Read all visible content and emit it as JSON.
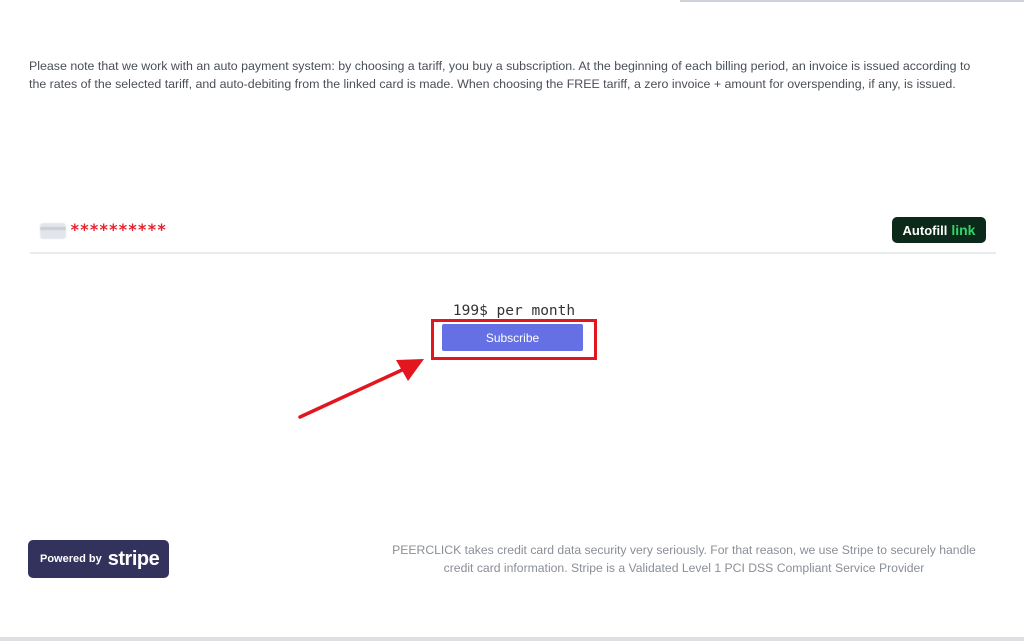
{
  "notice": {
    "text": "Please note that we work with an auto payment system: by choosing a tariff, you buy a subscription. At the beginning of each billing period, an invoice is issued according to the rates of the selected tariff, and auto-debiting from the linked card is made. When choosing the FREE tariff, a zero invoice + amount for overspending, if any, is issued."
  },
  "card": {
    "masked_number": "**********",
    "icon": "credit-card-icon",
    "autofill_label": "Autofill",
    "autofill_brand": "link"
  },
  "plan": {
    "price_text": "199$ per month",
    "subscribe_label": "Subscribe"
  },
  "footer": {
    "powered_by": "Powered by",
    "stripe_brand": "stripe",
    "security_text": "PEERCLICK takes credit card data security very seriously. For that reason, we use Stripe to securely handle credit card information. Stripe is a Validated Level 1 PCI DSS Compliant Service Provider"
  },
  "colors": {
    "subscribe_button": "#6570e5",
    "highlight_annotation": "#e3161f",
    "autofill_background": "#0b2a19",
    "autofill_link": "#33d46b",
    "stripe_badge": "#32325d",
    "masked_number": "#e8232f"
  }
}
